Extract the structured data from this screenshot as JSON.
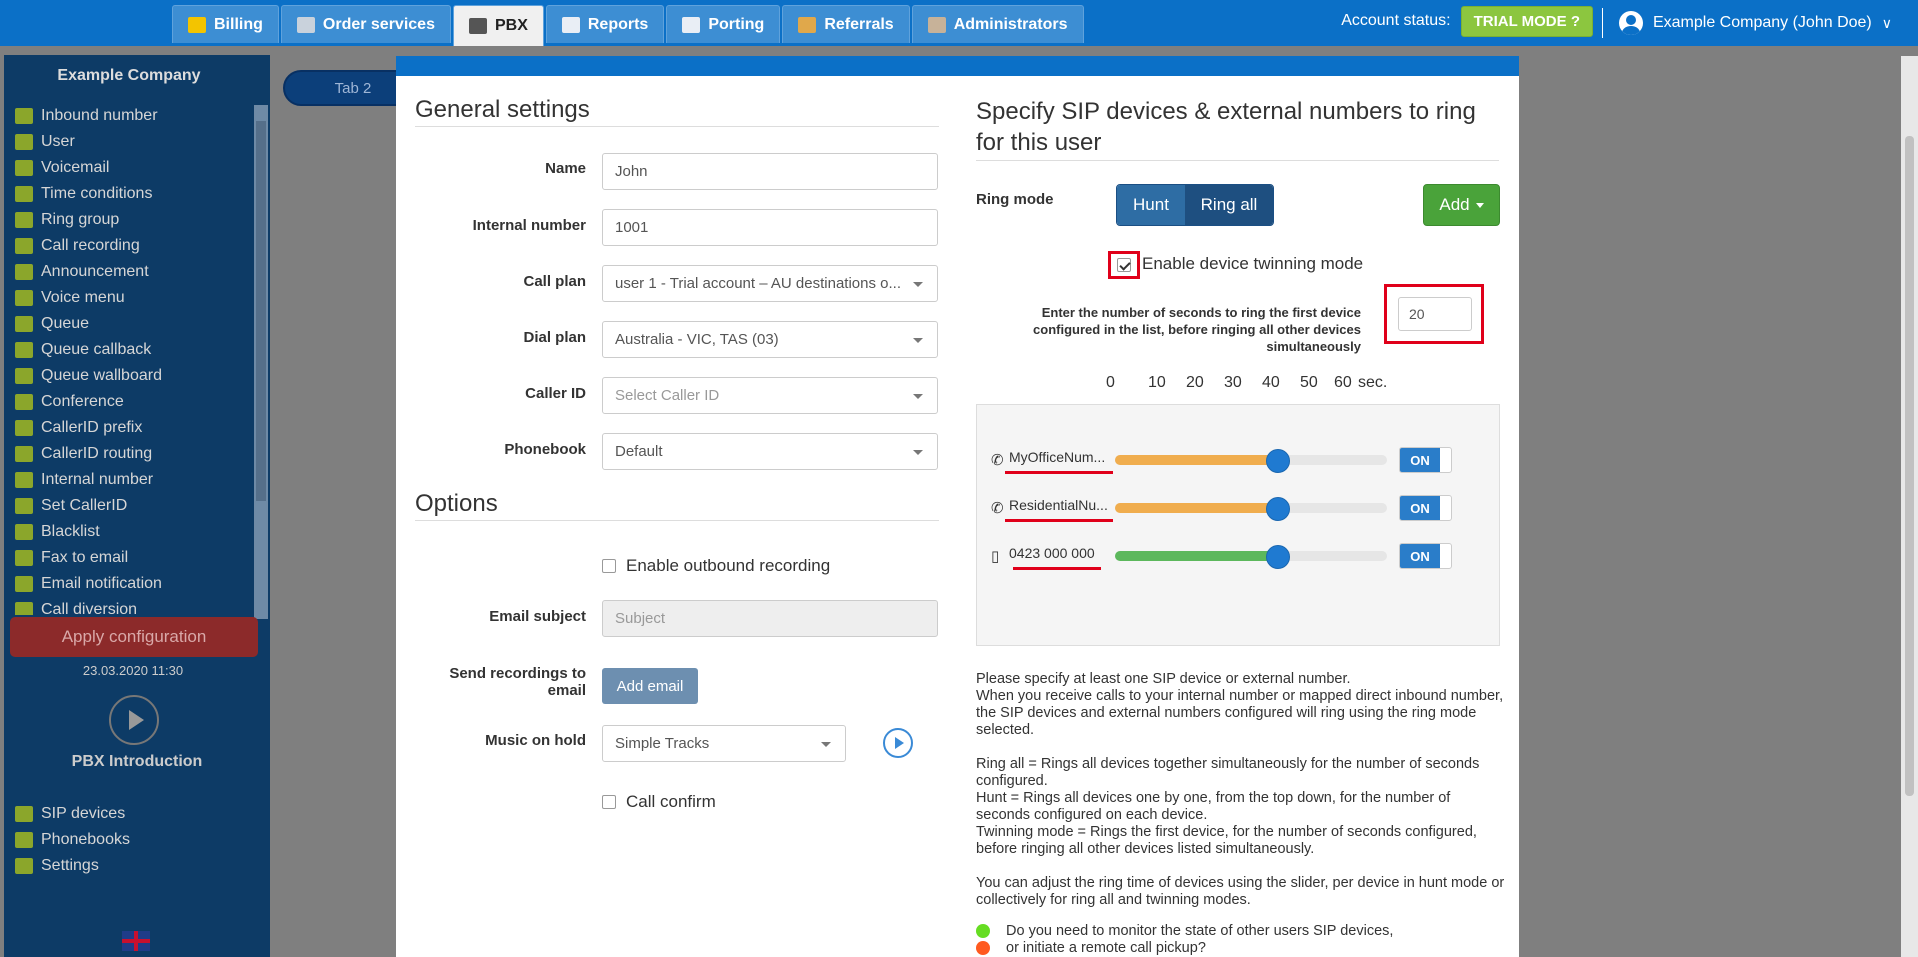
{
  "nav": {
    "tabs": [
      {
        "label": "Billing",
        "color": "#f3c400"
      },
      {
        "label": "Order services",
        "color": "#c9d2dc"
      },
      {
        "label": "PBX",
        "color": "#555555"
      },
      {
        "label": "Reports",
        "color": "#e9eef5"
      },
      {
        "label": "Porting",
        "color": "#e9eef5"
      },
      {
        "label": "Referrals",
        "color": "#e0a84b"
      },
      {
        "label": "Administrators",
        "color": "#c7b299"
      }
    ],
    "active_tab": "PBX",
    "account_status_label": "Account status:",
    "trial_label": "TRIAL MODE",
    "trial_icon": "question-circle-icon",
    "user_label": "Example Company (John Doe)"
  },
  "sidebar": {
    "company": "Example Company",
    "items": [
      "Inbound number",
      "User",
      "Voicemail",
      "Time conditions",
      "Ring group",
      "Call recording",
      "Announcement",
      "Voice menu",
      "Queue",
      "Queue callback",
      "Queue wallboard",
      "Conference",
      "CallerID prefix",
      "CallerID routing",
      "Internal number",
      "Set CallerID",
      "Blacklist",
      "Fax to email",
      "Email notification",
      "Call diversion"
    ],
    "apply_label": "Apply configuration",
    "apply_date": "23.03.2020 11:30",
    "intro_label": "PBX Introduction",
    "bottom_items": [
      "SIP devices",
      "Phonebooks",
      "Settings"
    ]
  },
  "tab2_label": "Tab 2",
  "general": {
    "heading": "General settings",
    "name_label": "Name",
    "name_value": "John",
    "internal_label": "Internal number",
    "internal_value": "1001",
    "callplan_label": "Call plan",
    "callplan_value": "user 1 - Trial account – AU destinations o...",
    "dialplan_label": "Dial plan",
    "dialplan_value": "Australia - VIC, TAS (03)",
    "callerid_label": "Caller ID",
    "callerid_placeholder": "Select Caller ID",
    "phonebook_label": "Phonebook",
    "phonebook_value": "Default"
  },
  "options": {
    "heading": "Options",
    "outbound_label": "Enable outbound recording",
    "email_subject_label": "Email subject",
    "email_subject_placeholder": "Subject",
    "send_rec_label": "Send recordings to email",
    "add_email_label": "Add email",
    "moh_label": "Music on hold",
    "moh_value": "Simple Tracks",
    "call_confirm_label": "Call confirm"
  },
  "ring": {
    "heading": "Specify SIP devices & external numbers to ring for this user",
    "ring_mode_label": "Ring mode",
    "hunt_label": "Hunt",
    "ring_all_label": "Ring all",
    "add_label": "Add",
    "twin_label": "Enable device twinning mode",
    "twin_checked": true,
    "seconds_text": "Enter the number of seconds to ring the first device configured in the list, before ringing all other devices simultaneously",
    "seconds_value": "20",
    "scale": [
      "0",
      "10",
      "20",
      "30",
      "40",
      "50",
      "60",
      "sec."
    ],
    "devices": [
      {
        "name": "MyOfficeNum...",
        "icon": "phone-icon",
        "value_sec": 36,
        "fill": "#f0ad4e",
        "toggle": "ON"
      },
      {
        "name": "ResidentialNu...",
        "icon": "phone-icon",
        "value_sec": 36,
        "fill": "#f0ad4e",
        "toggle": "ON"
      },
      {
        "name": "0423 000 000",
        "icon": "mobile-icon",
        "value_sec": 36,
        "fill": "#5cb85c",
        "toggle": "ON"
      }
    ],
    "help": [
      "Please specify at least one SIP device or external number.",
      "When you receive calls to your internal number or mapped direct inbound number, the SIP devices and external numbers configured will ring using the ring mode selected.",
      "Ring all = Rings all devices together simultaneously for the number of seconds configured.",
      "Hunt = Rings all devices one by one, from the top down, for the number of seconds configured on each device.",
      "Twinning mode = Rings the first device, for the number of seconds configured, before ringing all other devices listed simultaneously.",
      "You can adjust the ring time of devices using the slider, per device in hunt mode or collectively for ring all and twinning modes."
    ],
    "monitor_1": "Do you need to monitor the state of other users SIP devices,",
    "monitor_2": "or initiate a remote call pickup?"
  }
}
